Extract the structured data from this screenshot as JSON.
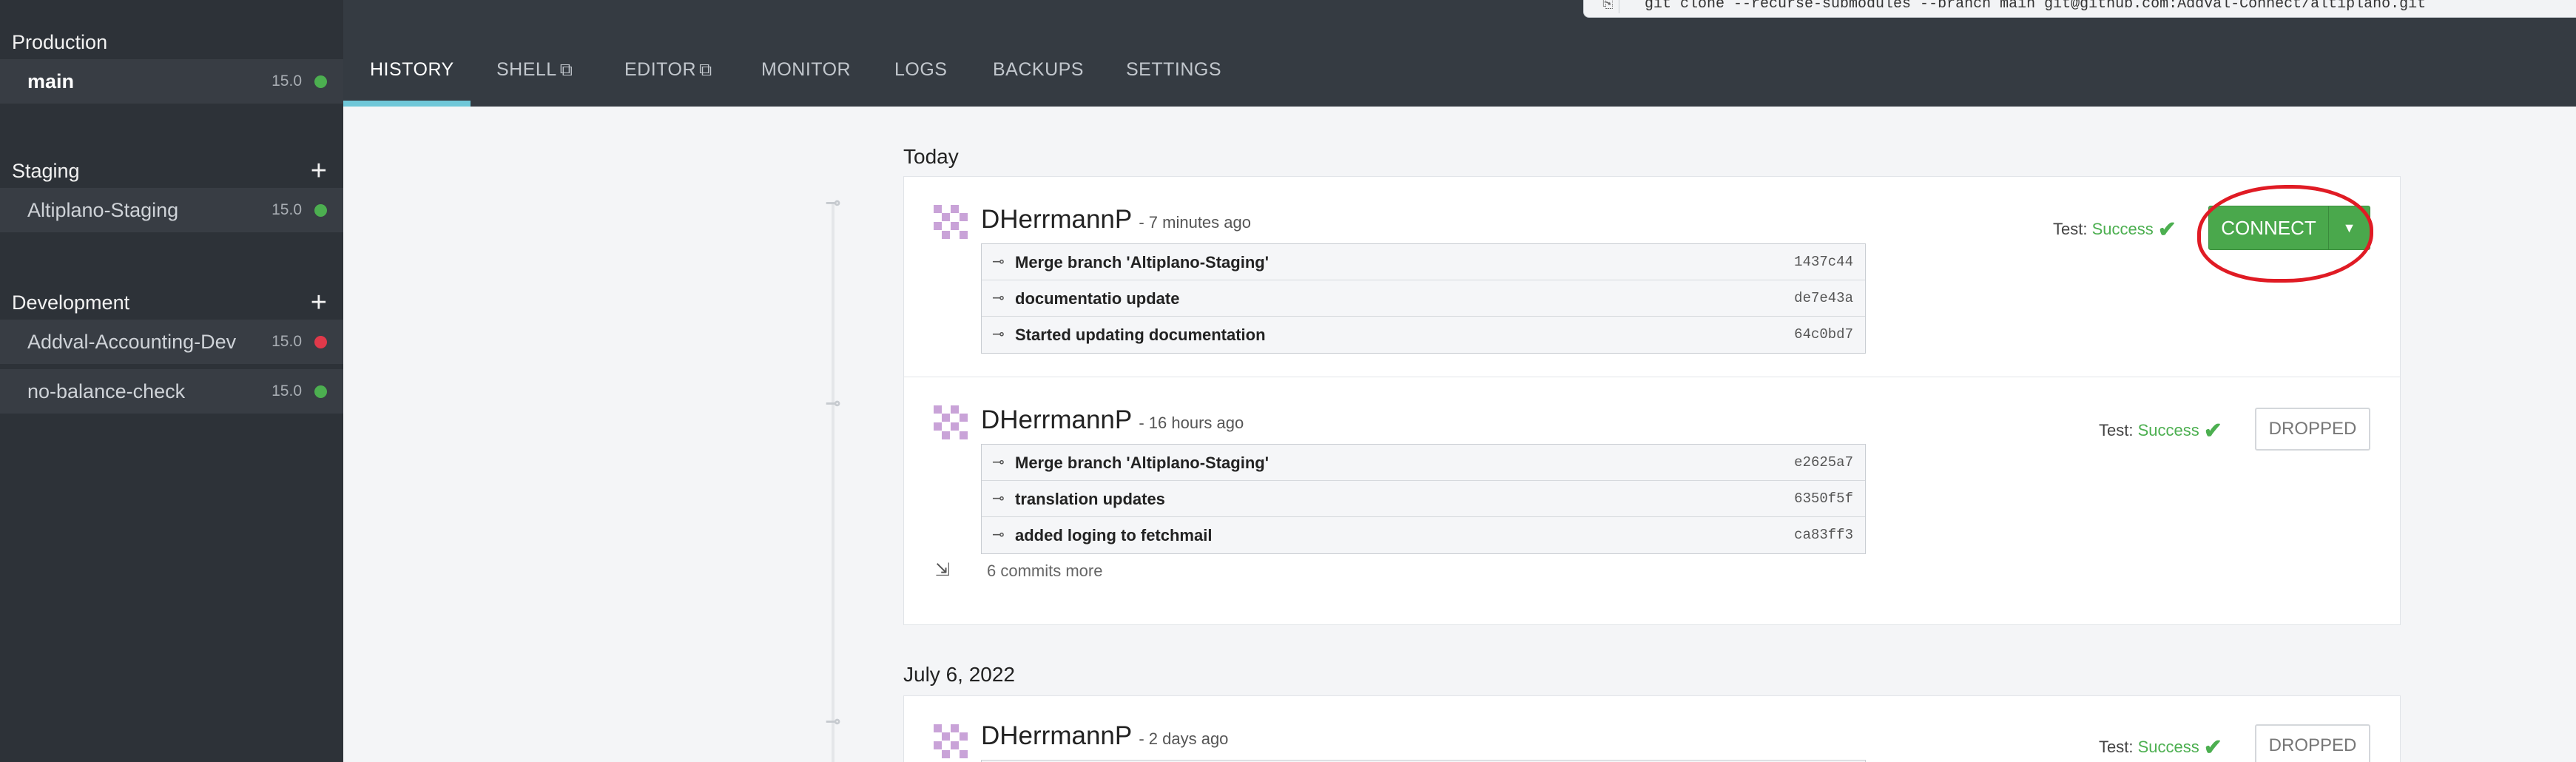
{
  "git_clone": "git clone --recurse-submodules --branch main git@github.com:Addval-Connect/altiplano.git",
  "sidebar": {
    "groups": [
      {
        "title": "Production",
        "items": [
          {
            "name": "main",
            "version": "15.0",
            "status_color": "#4caf50"
          }
        ]
      },
      {
        "title": "Staging",
        "items": [
          {
            "name": "Altiplano-Staging",
            "version": "15.0",
            "status_color": "#4caf50"
          }
        ]
      },
      {
        "title": "Development",
        "items": [
          {
            "name": "Addval-Accounting-Dev",
            "version": "15.0",
            "status_color": "#e0394a"
          },
          {
            "name": "no-balance-check",
            "version": "15.0",
            "status_color": "#4caf50"
          }
        ]
      }
    ]
  },
  "tabs": [
    {
      "label": "HISTORY",
      "active": true
    },
    {
      "label": "SHELL",
      "external_icon": "external-link-icon"
    },
    {
      "label": "EDITOR",
      "external_icon": "external-link-icon"
    },
    {
      "label": "MONITOR"
    },
    {
      "label": "LOGS"
    },
    {
      "label": "BACKUPS"
    },
    {
      "label": "SETTINGS"
    }
  ],
  "history": {
    "days": [
      {
        "label": "Today"
      },
      {
        "label": "July 6, 2022"
      }
    ],
    "builds": [
      {
        "author": "DHerrmannP",
        "ago": "7 minutes ago",
        "test_label": "Test:",
        "test_status": "Success",
        "action": "CONNECT",
        "commits": [
          {
            "message": "Merge branch 'Altiplano-Staging'",
            "sha": "1437c44"
          },
          {
            "message": "documentatio update",
            "sha": "de7e43a"
          },
          {
            "message": "Started updating documentation",
            "sha": "64c0bd7"
          }
        ]
      },
      {
        "author": "DHerrmannP",
        "ago": "16 hours ago",
        "test_label": "Test:",
        "test_status": "Success",
        "action": "DROPPED",
        "commits": [
          {
            "message": "Merge branch 'Altiplano-Staging'",
            "sha": "e2625a7"
          },
          {
            "message": "translation updates",
            "sha": "6350f5f"
          },
          {
            "message": "added loging to fetchmail",
            "sha": "ca83ff3"
          }
        ],
        "more": "6 commits more"
      },
      {
        "author": "DHerrmannP",
        "ago": "2 days ago",
        "test_label": "Test:",
        "test_status": "Success",
        "action": "DROPPED",
        "commits": []
      }
    ]
  },
  "colors": {
    "success": "#4caf50",
    "error": "#e0394a",
    "accent": "#6fc7d8",
    "connect": "#4aa84c",
    "annotation": "#e01b24"
  }
}
